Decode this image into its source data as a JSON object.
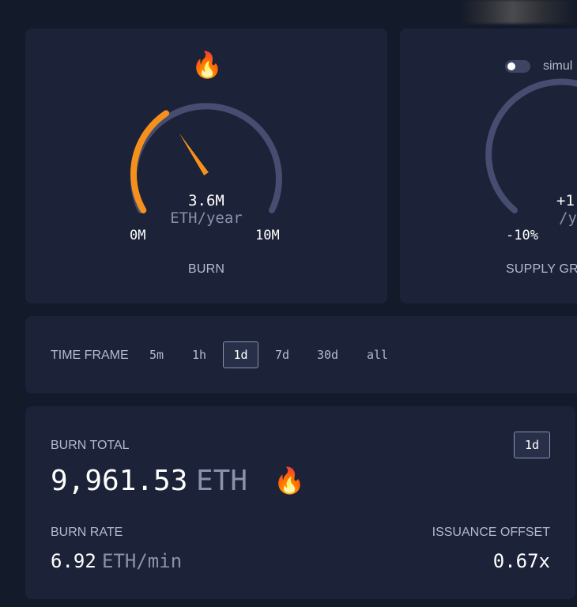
{
  "burn_gauge": {
    "icon": "flame-emoji",
    "value": "3.6M",
    "unit": "ETH/year",
    "min_label": "0M",
    "max_label": "10M",
    "caption": "BURN",
    "fill_fraction": 0.36,
    "track_color": "#474d70",
    "fill_color": "#f5901d"
  },
  "supply_gauge": {
    "toggle_label": "simul",
    "value": "+1",
    "unit": "/y",
    "min_label": "-10%",
    "caption": "SUPPLY GRO",
    "track_color": "#474d70",
    "toggle_on": false
  },
  "timeframe": {
    "label": "TIME FRAME",
    "options": [
      "5m",
      "1h",
      "1d",
      "7d",
      "30d",
      "all"
    ],
    "selected": "1d"
  },
  "burn_total": {
    "label": "BURN TOTAL",
    "badge": "1d",
    "value": "9,961.53",
    "unit": "ETH",
    "icon": "flame-emoji",
    "burn_rate_label": "BURN RATE",
    "burn_rate_value": "6.92",
    "burn_rate_unit": "ETH/min",
    "issuance_offset_label": "ISSUANCE OFFSET",
    "issuance_offset_value": "0.67x"
  },
  "colors": {
    "background": "#131a29",
    "card": "#1c2237",
    "accent": "#f5901d",
    "muted_text": "#8991ad"
  }
}
